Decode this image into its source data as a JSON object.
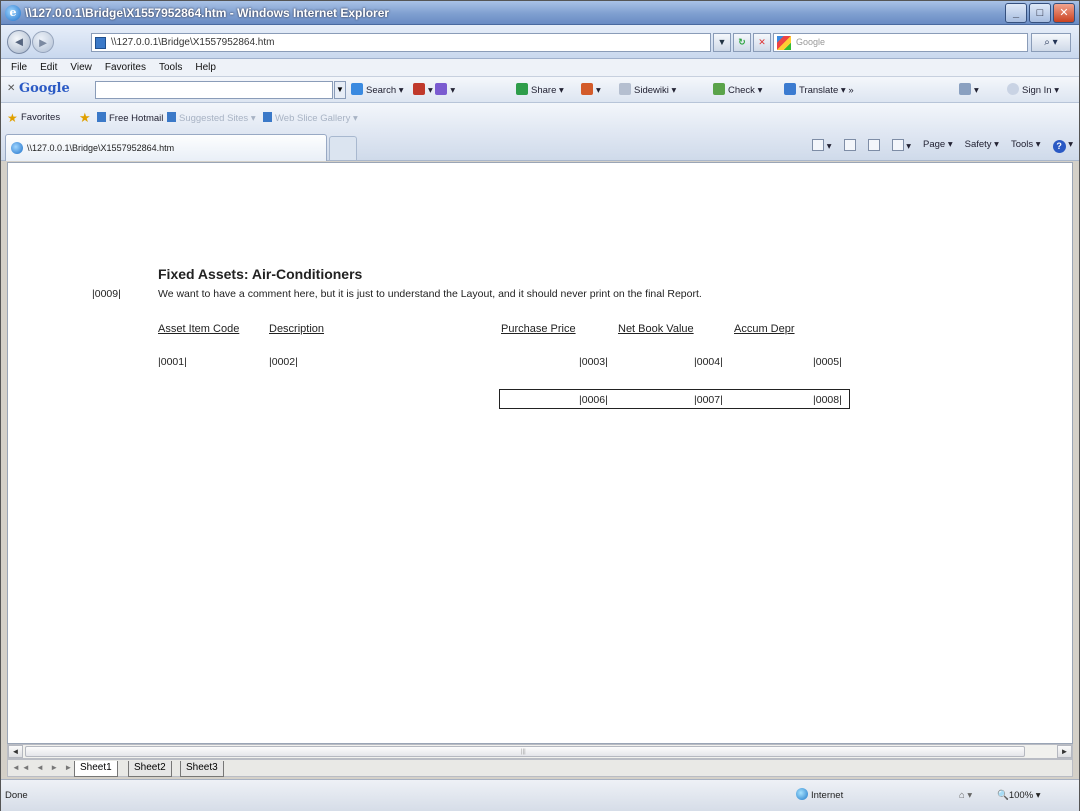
{
  "window": {
    "title": "\\\\127.0.0.1\\Bridge\\X1557952864.htm - Windows Internet Explorer",
    "minimize": "_",
    "maximize": "□",
    "close": "✕"
  },
  "address_bar": {
    "url": "\\\\127.0.0.1\\Bridge\\X1557952864.htm",
    "search_placeholder": "Google"
  },
  "menu": [
    "File",
    "Edit",
    "View",
    "Favorites",
    "Tools",
    "Help"
  ],
  "google_toolbar": {
    "brand": "Google",
    "search_label": "Search",
    "share_label": "Share",
    "sidewiki_label": "Sidewiki",
    "check_label": "Check",
    "translate_label": "Translate",
    "more": "»",
    "sign_in_label": "Sign In"
  },
  "favorites_bar": {
    "favorites_label": "Favorites",
    "links": [
      "Free Hotmail",
      "Suggested Sites",
      "Web Slice Gallery"
    ]
  },
  "tab": {
    "title": "\\\\127.0.0.1\\Bridge\\X1557952864.htm"
  },
  "command_bar": {
    "page_label": "Page",
    "safety_label": "Safety",
    "tools_label": "Tools"
  },
  "report": {
    "title": "Fixed Assets: Air-Conditioners",
    "comment_code": "|0009|",
    "comment": "We want to have a comment here, but it is just to understand the Layout, and it should never print on the final Report.",
    "headers": {
      "asset_item_code": "Asset Item Code",
      "description": "Description",
      "purchase_price": "Purchase Price",
      "net_book_value": "Net Book Value",
      "accum_depr": "Accum Depr"
    },
    "detail_row": [
      "|0001|",
      "|0002|",
      "|0003|",
      "|0004|",
      "|0005|"
    ],
    "totals_row": [
      "|0006|",
      "|0007|",
      "|0008|"
    ]
  },
  "sheets": {
    "nav": "◄◄ ◄ ► ►►",
    "tabs": [
      "Sheet1",
      "Sheet2",
      "Sheet3"
    ]
  },
  "status_bar": {
    "status": "Done",
    "zone": "Internet",
    "zoom": "100%"
  }
}
